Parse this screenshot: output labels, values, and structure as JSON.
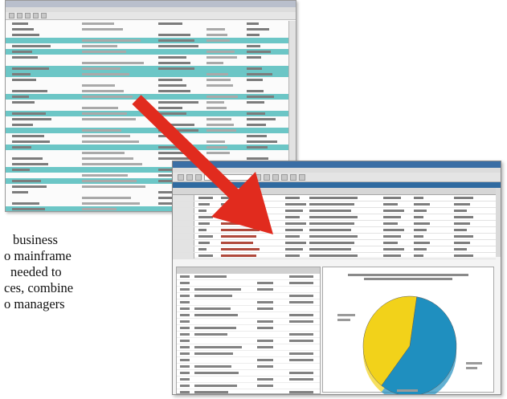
{
  "paragraph": {
    "lines": [
      "business",
      "o mainframe",
      "needed to",
      "ces, combine",
      "o managers"
    ]
  },
  "colors": {
    "report_band": "#6cc6c6",
    "arrow": "#e12b1e",
    "pie_blue": "#1f8fbf",
    "pie_yellow": "#f2d21a"
  },
  "chart_data": {
    "type": "pie",
    "values": [
      58,
      42
    ]
  },
  "icons": [
    "arrow-icon",
    "pie-chart-icon"
  ]
}
